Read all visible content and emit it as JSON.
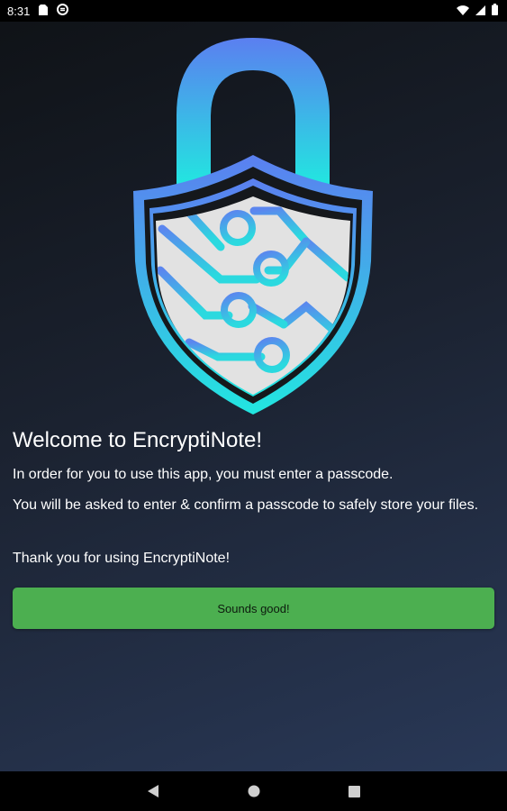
{
  "status_bar": {
    "time": "8:31",
    "icons_left": [
      "sim-card-icon",
      "sync-icon"
    ],
    "icons_right": [
      "wifi-icon",
      "signal-icon",
      "battery-icon"
    ]
  },
  "logo": {
    "icon": "padlock-shield-circuit-icon",
    "colors": {
      "gradient_top": "#5b7ff0",
      "gradient_bottom": "#22e6e0",
      "shield_fill": "#e2e2e2",
      "dark": "#15181c"
    }
  },
  "welcome": {
    "title": "Welcome to EncryptiNote!",
    "paragraph_1": "In order for you to use this app, you must enter a passcode.",
    "paragraph_2": "You will be asked to enter & confirm a passcode to safely store your files.",
    "paragraph_3": "Thank you for using EncryptiNote!"
  },
  "button": {
    "label": "Sounds good!",
    "color": "#4caf50"
  },
  "nav_bar": {
    "icons": [
      "back-icon",
      "home-icon",
      "recents-icon"
    ]
  }
}
